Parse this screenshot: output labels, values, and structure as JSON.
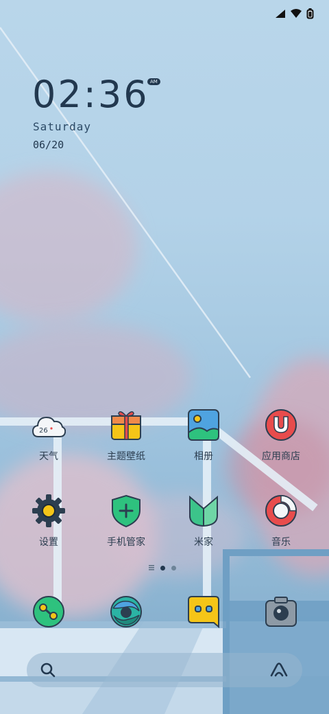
{
  "status_bar": {
    "icons": [
      "signal-icon",
      "wifi-icon",
      "battery-icon"
    ]
  },
  "clock": {
    "time": "02:36",
    "ampm": "AM",
    "day": "Saturday",
    "date": "06/20"
  },
  "apps": [
    {
      "label": "天气",
      "icon": "weather-icon",
      "temp": "26"
    },
    {
      "label": "主题壁纸",
      "icon": "themes-icon"
    },
    {
      "label": "相册",
      "icon": "gallery-icon"
    },
    {
      "label": "应用商店",
      "icon": "app-store-icon"
    },
    {
      "label": "设置",
      "icon": "settings-icon"
    },
    {
      "label": "手机管家",
      "icon": "security-icon"
    },
    {
      "label": "米家",
      "icon": "mi-home-icon"
    },
    {
      "label": "音乐",
      "icon": "music-icon"
    }
  ],
  "dock": [
    {
      "icon": "phone-icon"
    },
    {
      "icon": "browser-icon"
    },
    {
      "icon": "messages-icon"
    },
    {
      "icon": "camera-icon"
    }
  ],
  "page_indicator": {
    "pages": 2,
    "current": 1
  },
  "search": {
    "icons": [
      "search-icon",
      "assistant-icon"
    ]
  },
  "colors": {
    "text": "#22384f",
    "accent_yellow": "#f5c518",
    "accent_green": "#2ec27e",
    "accent_red": "#e84c4c"
  }
}
